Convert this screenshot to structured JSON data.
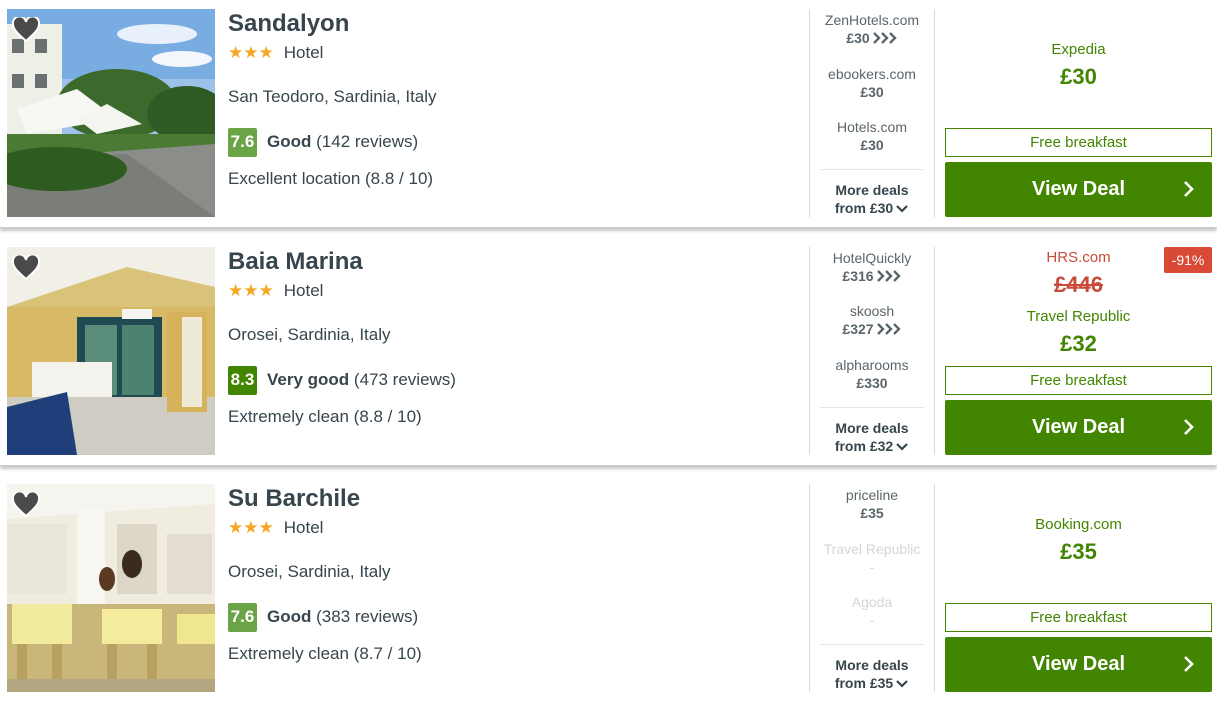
{
  "hotels": [
    {
      "name": "Sandalyon",
      "stars": "★★★",
      "type": "Hotel",
      "location": "San Teodoro, Sardinia, Italy",
      "score": "7.6",
      "rating_word": "Good",
      "reviews": "(142 reviews)",
      "subrating": "Excellent location (8.8 / 10)",
      "alternatives": [
        {
          "provider": "ZenHotels.com",
          "price": "£30",
          "arrow": true,
          "dim": false
        },
        {
          "provider": "ebookers.com",
          "price": "£30",
          "arrow": false,
          "dim": false
        },
        {
          "provider": "Hotels.com",
          "price": "£30",
          "arrow": false,
          "dim": false
        }
      ],
      "more_deals_line1": "More deals",
      "more_deals_line2": "from £30",
      "deal": {
        "partner": "Expedia",
        "price": "£30",
        "tag": "Free breakfast",
        "button": "View Deal"
      }
    },
    {
      "name": "Baia Marina",
      "stars": "★★★",
      "type": "Hotel",
      "location": "Orosei, Sardinia, Italy",
      "score": "8.3",
      "rating_word": "Very good",
      "reviews": "(473 reviews)",
      "subrating": "Extremely clean (8.8 / 10)",
      "alternatives": [
        {
          "provider": "HotelQuickly",
          "price": "£316",
          "arrow": true,
          "dim": false
        },
        {
          "provider": "skoosh",
          "price": "£327",
          "arrow": true,
          "dim": false
        },
        {
          "provider": "alpharooms",
          "price": "£330",
          "arrow": false,
          "dim": false
        }
      ],
      "more_deals_line1": "More deals",
      "more_deals_line2": "from £32",
      "deal": {
        "strike_partner": "HRS.com",
        "strike_price": "£446",
        "badge": "-91%",
        "partner": "Travel Republic",
        "price": "£32",
        "tag": "Free breakfast",
        "button": "View Deal"
      }
    },
    {
      "name": "Su Barchile",
      "stars": "★★★",
      "type": "Hotel",
      "location": "Orosei, Sardinia, Italy",
      "score": "7.6",
      "rating_word": "Good",
      "reviews": "(383 reviews)",
      "subrating": "Extremely clean (8.7 / 10)",
      "alternatives": [
        {
          "provider": "priceline",
          "price": "£35",
          "arrow": false,
          "dim": false
        },
        {
          "provider": "Travel Republic",
          "price": "-",
          "arrow": false,
          "dim": true
        },
        {
          "provider": "Agoda",
          "price": "-",
          "arrow": false,
          "dim": true
        }
      ],
      "more_deals_line1": "More deals",
      "more_deals_line2": "from £35",
      "deal": {
        "partner": "Booking.com",
        "price": "£35",
        "tag": "Free breakfast",
        "button": "View Deal"
      }
    }
  ],
  "colors": {
    "deal_green": "#428500",
    "score_good": "#6aa447",
    "score_very_good": "#428500",
    "star": "#f5a623",
    "strike_red": "#c94a38",
    "badge_red": "#d94a36"
  },
  "icons": {
    "favorite": "heart-icon",
    "provider_arrow": "triple-chevron-right-icon",
    "more": "chevron-down-icon",
    "button_arrow": "chevron-right-icon"
  }
}
